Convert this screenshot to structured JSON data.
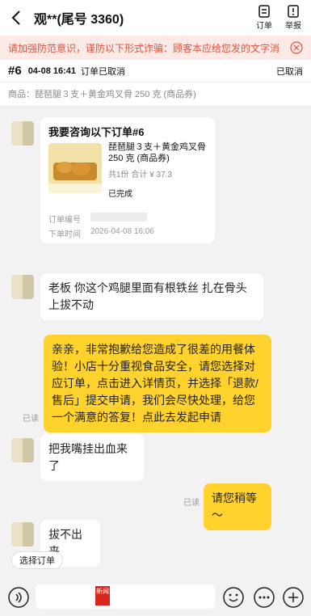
{
  "header": {
    "contact_name": "观**(尾号 3360)",
    "order_label": "订单",
    "report_label": "举报"
  },
  "warning": {
    "text": "请加强防范意识，谨防以下形式诈骗：顾客本应给您发的文字消息是..."
  },
  "order_bar": {
    "order_no": "#6",
    "time": "04-08 16:41",
    "status_left": "订单已取消",
    "status_right": "已取消"
  },
  "goods_bar": {
    "text": "商品：琵琶腿３支＋黄金鸡叉骨 250 克 (商品券)"
  },
  "order_card": {
    "title": "我要咨询以下订单#6",
    "goods_name": "琵琶腿３支＋黄金鸡叉骨 250 克 (商品券)",
    "qty_total": "共1份 合计 ¥ 37.3",
    "state": "已完成",
    "order_no_label": "订单编号",
    "order_time_label": "下单时间",
    "order_time_value": "2026-04-08 16:06"
  },
  "messages": [
    {
      "side": "left",
      "text": "老板 你这个鸡腿里面有根铁丝 扎在骨头上拔不动"
    },
    {
      "side": "right",
      "text": "亲亲，非常抱歉给您造成了很差的用餐体验！小店十分重视食品安全，请您选择对应订单，点击进入详情页，并选择「退款/售后」提交申请，我们会尽快处理，给您一个满意的答复！点此去发起申请",
      "read": "已读"
    },
    {
      "side": "left",
      "text": "把我嘴挂出血来了"
    },
    {
      "side": "right",
      "text": "请您稍等～",
      "read": "已读"
    },
    {
      "side": "left",
      "text": "拔不出来"
    }
  ],
  "bottom": {
    "select_order_label": "选择订单",
    "news_logo_text": "新闻"
  },
  "colors": {
    "accent_yellow": "#ffd22e",
    "warning_red": "#e0533d",
    "warning_bg": "#fde9e6",
    "page_bg": "#f2f2f2"
  },
  "icons": [
    "back-arrow-icon",
    "order-list-icon",
    "report-icon",
    "close-icon",
    "voice-icon",
    "emoji-icon",
    "more-icon",
    "plus-icon"
  ]
}
